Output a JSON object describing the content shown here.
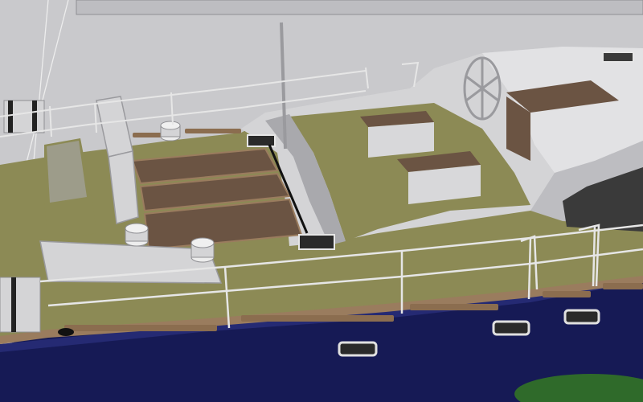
{
  "scene": {
    "subject": "yacht-deck-render",
    "colors": {
      "background": "#c9c9cc",
      "deck": "#8c8a55",
      "deck_dark": "#6f6d3e",
      "hull": "#161a55",
      "hull_light": "#252a73",
      "cabin": "#d4d4d6",
      "cabin_shade": "#a9a9ad",
      "teak": "#6b5443",
      "teak_trim": "#9a7c5e",
      "rail": "#e6e6e6",
      "metal": "#9a9a9e",
      "window": "#3a3a3a",
      "keel": "#2f6a2a"
    }
  }
}
